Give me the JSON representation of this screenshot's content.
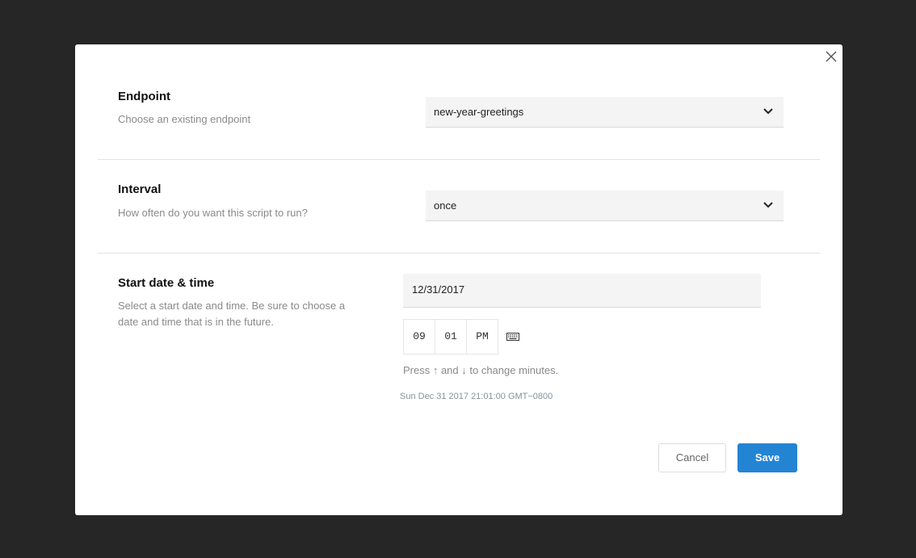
{
  "dialog": {
    "close_icon": "close-x-icon"
  },
  "endpoint": {
    "title": "Endpoint",
    "description": "Choose an existing endpoint",
    "selected": "new-year-greetings",
    "icon": "chevron-down-icon"
  },
  "interval": {
    "title": "Interval",
    "description": "How often do you want this script to run?",
    "selected": "once",
    "icon": "chevron-down-icon"
  },
  "start": {
    "title": "Start date & time",
    "description": "Select a start date and time. Be sure to choose a date and time that is in the future.",
    "date_value": "12/31/2017",
    "time": {
      "hour": "09",
      "minute": "01",
      "meridiem": "PM"
    },
    "keyboard_icon": "keyboard-icon",
    "hint": "Press ↑ and ↓ to change minutes.",
    "resolved_datetime": "Sun Dec 31 2017 21:01:00 GMT−0800"
  },
  "actions": {
    "cancel_label": "Cancel",
    "save_label": "Save"
  },
  "colors": {
    "primary": "#2484d4",
    "backdrop": "#262626"
  }
}
